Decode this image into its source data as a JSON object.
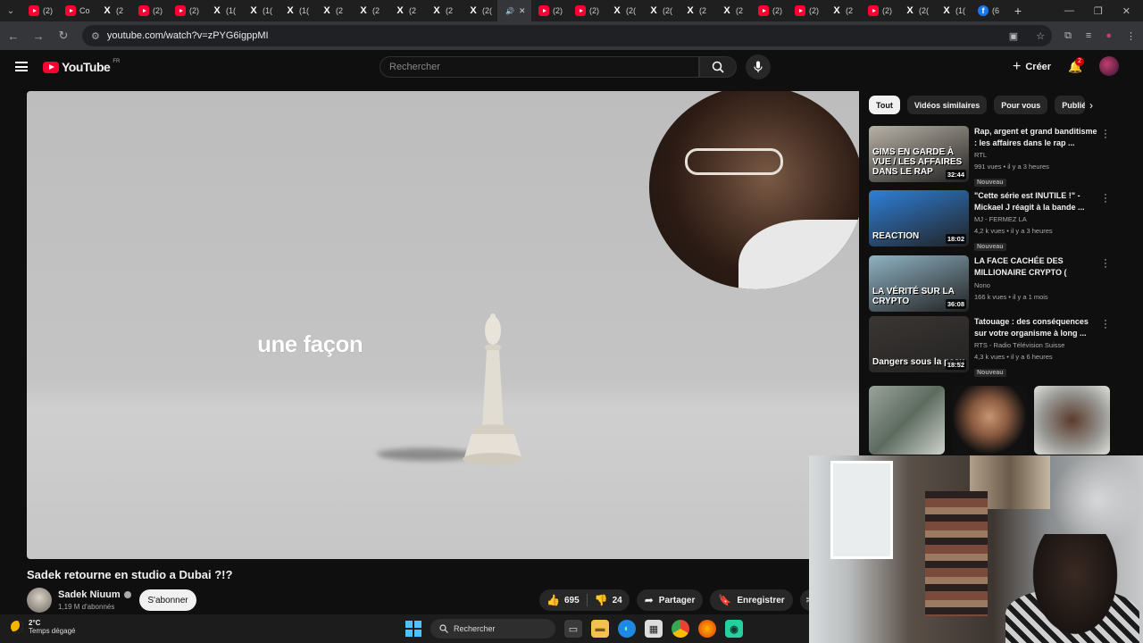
{
  "browser": {
    "tabs": [
      {
        "icon": "youtube-icon",
        "label": "(2)"
      },
      {
        "icon": "youtube-icon",
        "label": "Co"
      },
      {
        "icon": "x-icon",
        "label": "(2"
      },
      {
        "icon": "youtube-icon",
        "label": "(2)"
      },
      {
        "icon": "youtube-icon",
        "label": "(2)"
      },
      {
        "icon": "x-icon",
        "label": "(1("
      },
      {
        "icon": "x-icon",
        "label": "(1("
      },
      {
        "icon": "x-icon",
        "label": "(1("
      },
      {
        "icon": "x-icon",
        "label": "(2"
      },
      {
        "icon": "x-icon",
        "label": "(2"
      },
      {
        "icon": "x-icon",
        "label": "(2"
      },
      {
        "icon": "x-icon",
        "label": "(2"
      },
      {
        "icon": "x-icon",
        "label": "(2("
      },
      {
        "icon": "speaker-icon",
        "label": "✕",
        "active": true
      },
      {
        "icon": "youtube-icon",
        "label": "(2)"
      },
      {
        "icon": "youtube-icon",
        "label": "(2)"
      },
      {
        "icon": "x-icon",
        "label": "(2("
      },
      {
        "icon": "x-icon",
        "label": "(2("
      },
      {
        "icon": "x-icon",
        "label": "(2"
      },
      {
        "icon": "x-icon",
        "label": "(2"
      },
      {
        "icon": "youtube-icon",
        "label": "(2)"
      },
      {
        "icon": "youtube-icon",
        "label": "(2)"
      },
      {
        "icon": "x-icon",
        "label": "(2"
      },
      {
        "icon": "youtube-icon",
        "label": "(2)"
      },
      {
        "icon": "x-icon",
        "label": "(2("
      },
      {
        "icon": "x-icon",
        "label": "(1("
      },
      {
        "icon": "facebook-icon",
        "label": "(6"
      }
    ],
    "url": "youtube.com/watch?v=zPYG6igppMI"
  },
  "header": {
    "logo_text": "YouTube",
    "country": "FR",
    "search_placeholder": "Rechercher",
    "create_label": "Créer",
    "notif_count": "2"
  },
  "player": {
    "caption": "une façon"
  },
  "video": {
    "title": "Sadek retourne en studio a Dubai ?!?",
    "channel": "Sadek Niuum",
    "subscribers": "1,19 M d'abonnés",
    "subscribe_label": "S'abonner",
    "likes": "695",
    "dislikes": "24",
    "share_label": "Partager",
    "save_label": "Enregistrer"
  },
  "sidebar": {
    "chips": [
      "Tout",
      "Vidéos similaires",
      "Pour vous",
      "Publié"
    ],
    "recommendations": [
      {
        "title": "Rap, argent et grand banditisme : les affaires dans le rap ...",
        "channel": "RTL",
        "meta": "991 vues • il y a 3 heures",
        "duration": "32:44",
        "badge": "Nouveau",
        "thumb_text": "GIMS EN GARDE À VUE / LES AFFAIRES DANS LE RAP",
        "thumb_color": "#b8b2a6"
      },
      {
        "title": "\"Cette série est INUTILE !\" - Mickael J réagit à la bande ...",
        "channel": "MJ - FERMEZ LA",
        "meta": "4,2 k vues • il y a 3 heures",
        "duration": "18:02",
        "badge": "Nouveau",
        "thumb_text": "REACTION",
        "thumb_color": "#2f7fd8"
      },
      {
        "title": "LA FACE CACHÉE DES MILLIONAIRE CRYPTO ( Sadek...",
        "channel": "Nono",
        "meta": "166 k vues • il y a 1 mois",
        "duration": "36:08",
        "badge": "",
        "thumb_text": "LA VÉRITÉ SUR LA CRYPTO",
        "thumb_color": "#8fb3c4"
      },
      {
        "title": "Tatouage : des conséquences sur votre organisme à long ...",
        "channel": "RTS - Radio Télévision Suisse",
        "meta": "4,3 k vues • il y a 6 heures",
        "duration": "18:52",
        "badge": "Nouveau",
        "thumb_text": "Dangers sous la peau",
        "thumb_color": "#3b3633"
      }
    ]
  },
  "taskbar": {
    "temp": "2°C",
    "weather": "Temps dégagé",
    "search_label": "Rechercher"
  }
}
